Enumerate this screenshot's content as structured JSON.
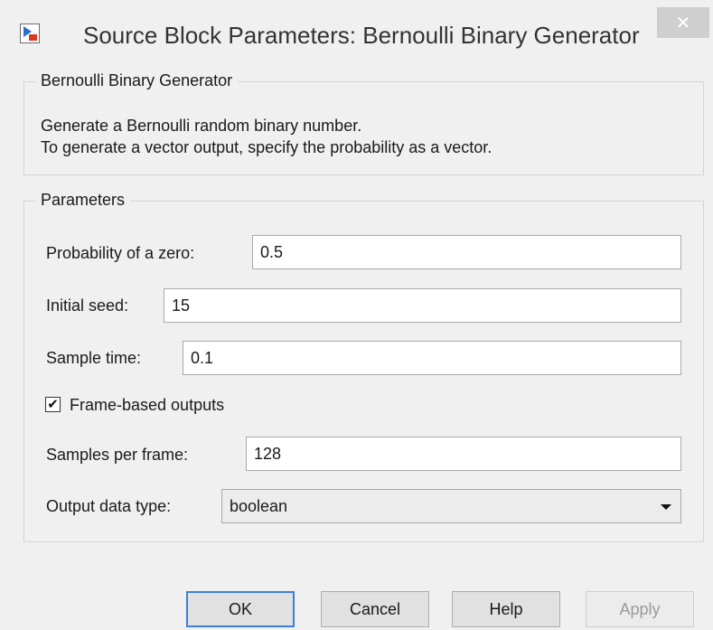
{
  "window": {
    "title": "Source Block Parameters: Bernoulli Binary Generator",
    "close_glyph": "✕",
    "app_icon": "simulink-block-icon"
  },
  "description": {
    "legend": "Bernoulli Binary Generator",
    "line1": "Generate a Bernoulli random binary number.",
    "line2": "To generate a vector output, specify the probability as a vector."
  },
  "parameters": {
    "legend": "Parameters",
    "probability": {
      "label": "Probability of a zero:",
      "value": "0.5"
    },
    "seed": {
      "label": "Initial seed:",
      "value": "15"
    },
    "sample_time": {
      "label": "Sample time:",
      "value": "0.1"
    },
    "frame_based": {
      "label": "Frame-based outputs",
      "checked": true,
      "check_glyph": "✔"
    },
    "samples_per_frame": {
      "label": "Samples per frame:",
      "value": "128"
    },
    "output_type": {
      "label": "Output data type:",
      "selected": "boolean"
    }
  },
  "buttons": {
    "ok": "OK",
    "cancel": "Cancel",
    "help": "Help",
    "apply": "Apply"
  },
  "colors": {
    "background": "#f0f0f0",
    "default_button_border": "#3c7fd4",
    "disabled_text": "#9a9a9a"
  }
}
